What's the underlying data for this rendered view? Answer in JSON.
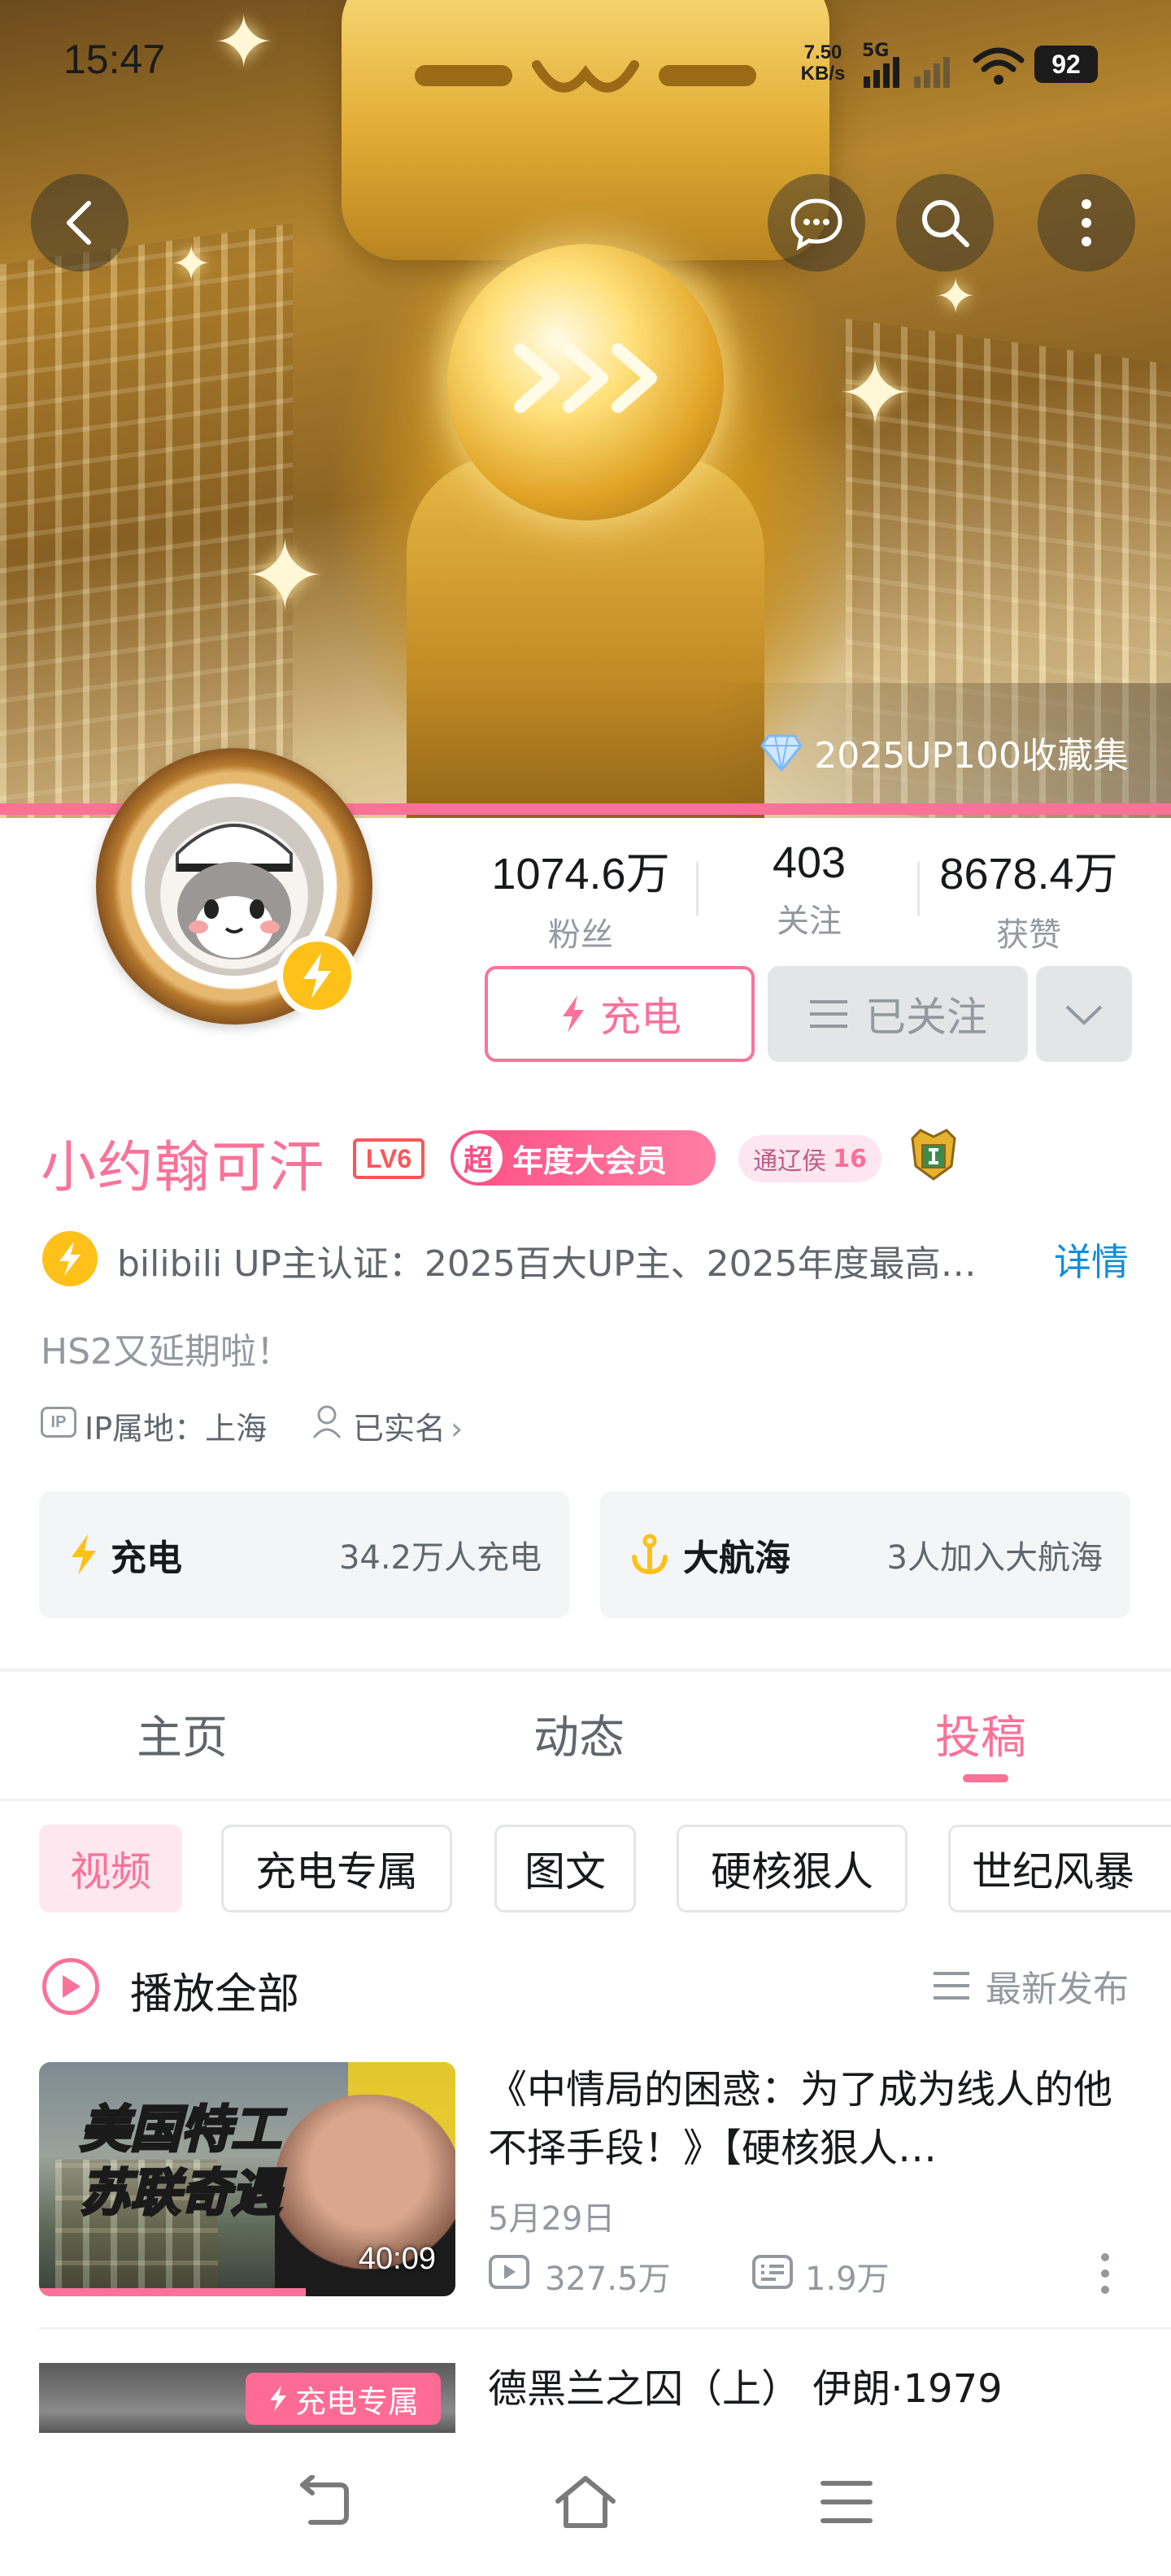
{
  "status_bar": {
    "time": "15:47",
    "net_speed_top": "7.50",
    "net_speed_bottom": "KB/s",
    "network": "5G",
    "battery": "92"
  },
  "banner": {
    "collection_label": "2025UP100收藏集"
  },
  "profile": {
    "stats": [
      {
        "value": "1074.6万",
        "label": "粉丝"
      },
      {
        "value": "403",
        "label": "关注"
      },
      {
        "value": "8678.4万",
        "label": "获赞"
      }
    ],
    "charge_button": "充电",
    "follow_button": "已关注",
    "name": "小约翰可汗",
    "level": "LV6",
    "vip_chao": "超",
    "vip_label": "年度大会员",
    "medal_name": "通辽侯",
    "medal_level": "16",
    "cert_text": "bilibili UP主认证：2025百大UP主、2025年度最高…",
    "cert_more": "详情",
    "sign": "HS2又延期啦！",
    "ip_icon": "IP",
    "ip_text": "IP属地：上海",
    "realname_text": "已实名",
    "realname_chevron": "›"
  },
  "cards": {
    "charge_title": "充电",
    "charge_value": "34.2万人充电",
    "voyage_title": "大航海",
    "voyage_value": "3人加入大航海"
  },
  "tabs": [
    "主页",
    "动态",
    "投稿"
  ],
  "filters": [
    "视频",
    "充电专属",
    "图文",
    "硬核狠人",
    "世纪风暴"
  ],
  "list": {
    "play_all": "播放全部",
    "sort": "最新发布"
  },
  "videos": [
    {
      "title": "《中情局的困惑：为了成为线人的他不择手段！》【硬核狠人…",
      "thumb_line1": "美国特工",
      "thumb_line2": "苏联奇遇",
      "duration": "40:09",
      "date": "5月29日",
      "views": "327.5万",
      "danmaku": "1.9万",
      "progress": 0.64
    },
    {
      "title": "德黑兰之囚（上） 伊朗·1979",
      "badge": "充电专属"
    }
  ],
  "colors": {
    "accent": "#fb7299",
    "link": "#0f8ddc",
    "charge_yellow": "#fdc11a"
  }
}
